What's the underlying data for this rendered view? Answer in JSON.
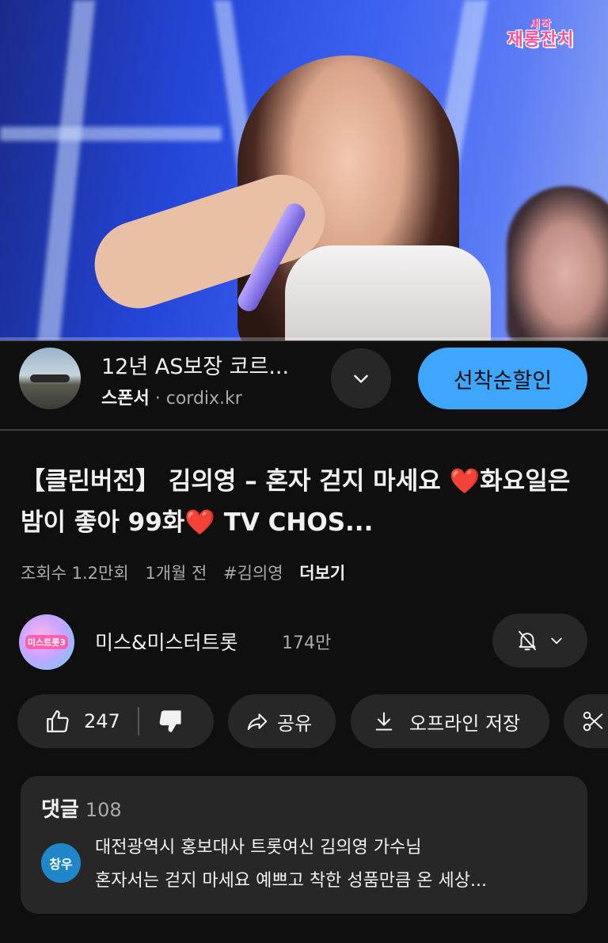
{
  "video": {
    "logo_top": "새작",
    "logo_main": "재롱잔치",
    "progress": 0.0
  },
  "ad": {
    "headline": "12년 AS보장 코르...",
    "sponsor_label": "스폰서",
    "separator": "·",
    "domain": "cordix.kr",
    "cta_label": "선착순할인",
    "expand_icon": "chevron-down-icon"
  },
  "title": {
    "heart_icon": "❤️",
    "part1": "【클린버전】 김의영 – 혼자 걷지 마세요 ",
    "part2": "화요일은 밤이 좋아 99화",
    "part3": " TV CHOS..."
  },
  "meta": {
    "views": "조회수 1.2만회",
    "age": "1개월 전",
    "hashtag": "#김의영",
    "more": "더보기"
  },
  "channel": {
    "avatar_text": "미스트롯3",
    "name": "미스&미스터트롯",
    "subscribers": "174만",
    "notify_icon": "bell-off-icon"
  },
  "actions": {
    "like_count": "247",
    "share_label": "공유",
    "offline_label": "오프라인 저장"
  },
  "comments": {
    "header": "댓글",
    "count": "108",
    "avatar_text": "창우",
    "line1": "대전광역시 홍보대사 트롯여신 김의영 가수님",
    "line2": "혼자서는 걷지 마세요 예쁘고 착한 성품만큼 온 세상..."
  },
  "colors": {
    "background": "#0f0f0f",
    "surface": "#272727",
    "accent_blue": "#3ea6ff",
    "text_primary": "#f1f1f1",
    "text_secondary": "#aaaaaa"
  }
}
